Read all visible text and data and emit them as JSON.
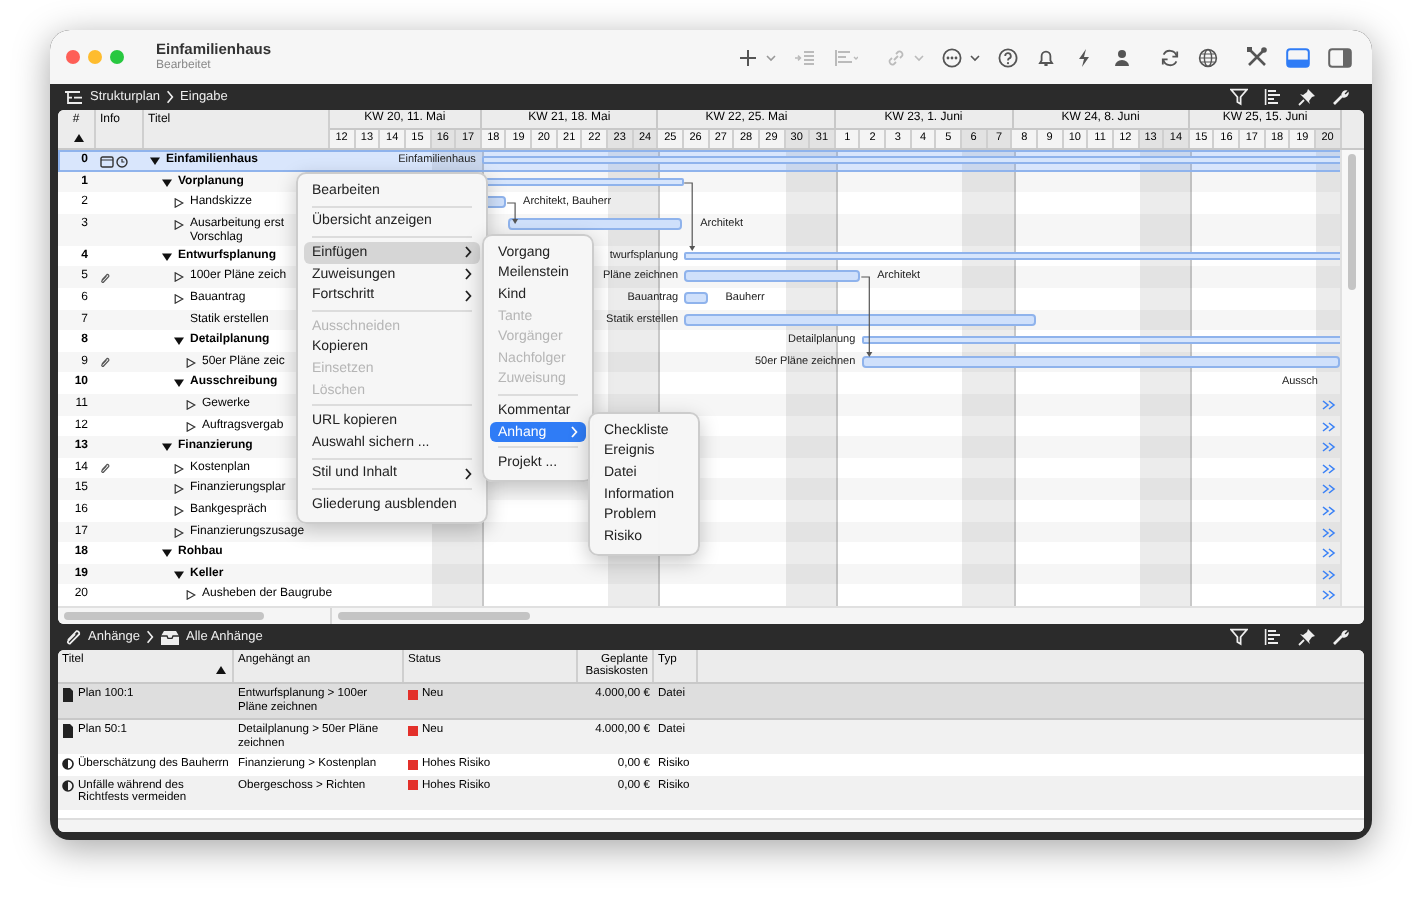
{
  "window": {
    "title": "Einfamilienhaus",
    "subtitle": "Bearbeitet"
  },
  "toolbar": {
    "panel_toggles": [
      {
        "selected": true
      },
      {
        "selected": false
      }
    ]
  },
  "breadcrumb": [
    "Strukturplan",
    "Eingabe"
  ],
  "outline": {
    "columns": [
      {
        "label": "#",
        "sorted": true
      },
      {
        "label": "Info",
        "sorted": false
      },
      {
        "label": "Titel",
        "sorted": false
      }
    ],
    "weeks": [
      {
        "label": "KW 20, 11. Mai",
        "days": [
          {
            "label": "12",
            "weekend": false
          },
          {
            "label": "13",
            "weekend": false
          },
          {
            "label": "14",
            "weekend": false
          },
          {
            "label": "15",
            "weekend": false
          },
          {
            "label": "16",
            "weekend": true
          },
          {
            "label": "17",
            "weekend": true
          }
        ]
      },
      {
        "label": "KW 21, 18. Mai",
        "days": [
          {
            "label": "18",
            "weekend": false
          },
          {
            "label": "19",
            "weekend": false
          },
          {
            "label": "20",
            "weekend": false
          },
          {
            "label": "21",
            "weekend": false
          },
          {
            "label": "22",
            "weekend": false
          },
          {
            "label": "23",
            "weekend": true
          },
          {
            "label": "24",
            "weekend": true
          }
        ]
      },
      {
        "label": "KW 22, 25. Mai",
        "days": [
          {
            "label": "25",
            "weekend": false
          },
          {
            "label": "26",
            "weekend": false
          },
          {
            "label": "27",
            "weekend": false
          },
          {
            "label": "28",
            "weekend": false
          },
          {
            "label": "29",
            "weekend": false
          },
          {
            "label": "30",
            "weekend": true
          },
          {
            "label": "31",
            "weekend": true
          }
        ]
      },
      {
        "label": "KW 23, 1. Juni",
        "days": [
          {
            "label": "1",
            "weekend": false
          },
          {
            "label": "2",
            "weekend": false
          },
          {
            "label": "3",
            "weekend": false
          },
          {
            "label": "4",
            "weekend": false
          },
          {
            "label": "5",
            "weekend": false
          },
          {
            "label": "6",
            "weekend": true
          },
          {
            "label": "7",
            "weekend": true
          }
        ]
      },
      {
        "label": "KW 24, 8. Juni",
        "days": [
          {
            "label": "8",
            "weekend": false
          },
          {
            "label": "9",
            "weekend": false
          },
          {
            "label": "10",
            "weekend": false
          },
          {
            "label": "11",
            "weekend": false
          },
          {
            "label": "12",
            "weekend": false
          },
          {
            "label": "13",
            "weekend": true
          },
          {
            "label": "14",
            "weekend": true
          }
        ]
      },
      {
        "label": "KW 25, 15. Juni",
        "days": [
          {
            "label": "15",
            "weekend": false
          },
          {
            "label": "16",
            "weekend": false
          },
          {
            "label": "17",
            "weekend": false
          },
          {
            "label": "18",
            "weekend": false
          },
          {
            "label": "19",
            "weekend": false
          },
          {
            "label": "20",
            "weekend": true
          }
        ]
      }
    ],
    "rows": [
      {
        "number": "0",
        "title": "Einfamilienhaus",
        "selected": true,
        "expanded": true,
        "note": true,
        "deadline": true,
        "attachment": false,
        "more_right": false,
        "bar": {
          "kind": "summary"
        },
        "label_left": "Einfamilienhaus",
        "children": [
          {
            "number": "1",
            "title": "Vorplanung",
            "selected": false,
            "expanded": true,
            "attachment": false,
            "more_right": false,
            "bar": {
              "kind": "summary"
            },
            "children": [
              {
                "number": "2",
                "title": "Handskizze",
                "selected": false,
                "expanded": false,
                "attachment": false,
                "more_right": false,
                "bar": {
                  "kind": "task"
                },
                "label_right": "Architekt, Bauherr"
              },
              {
                "number": "3",
                "title": "Ausarbeitung erst\nVorschlag",
                "selected": false,
                "expanded": false,
                "attachment": false,
                "more_right": false,
                "bar": {
                  "kind": "task"
                },
                "label_right": "Architekt"
              }
            ]
          },
          {
            "number": "4",
            "title": "Entwurfsplanung",
            "selected": false,
            "expanded": true,
            "attachment": false,
            "more_right": false,
            "bar": {
              "kind": "summary"
            },
            "label_left": "twurfsplanung",
            "children": [
              {
                "number": "5",
                "title": "100er Pläne zeich",
                "selected": false,
                "expanded": false,
                "attachment": true,
                "more_right": false,
                "bar": {
                  "kind": "task"
                },
                "label_left": "Pläne zeichnen",
                "label_right": "Architekt"
              },
              {
                "number": "6",
                "title": "Bauantrag",
                "selected": false,
                "expanded": false,
                "attachment": false,
                "more_right": false,
                "bar": {
                  "kind": "task"
                },
                "label_left": "Bauantrag",
                "label_right": "Bauherr"
              },
              {
                "number": "7",
                "title": "Statik erstellen",
                "selected": false,
                "attachment": false,
                "more_right": false,
                "bar": {
                  "kind": "task"
                },
                "label_left": "Statik erstellen"
              },
              {
                "number": "8",
                "title": "Detailplanung",
                "selected": false,
                "expanded": true,
                "attachment": false,
                "more_right": false,
                "bar": {
                  "kind": "summary"
                },
                "label_left": "Detailplanung",
                "children": [
                  {
                    "number": "9",
                    "title": "50er Pläne zeic",
                    "selected": false,
                    "expanded": false,
                    "attachment": true,
                    "more_right": false,
                    "bar": {
                      "kind": "task"
                    },
                    "label_left": "50er Pläne zeichnen"
                  }
                ]
              },
              {
                "number": "10",
                "title": "Ausschreibung",
                "selected": false,
                "expanded": true,
                "attachment": false,
                "more_right": false,
                "label_left": "Aussch",
                "children": [
                  {
                    "number": "11",
                    "title": "Gewerke",
                    "selected": false,
                    "expanded": false,
                    "attachment": false,
                    "more_right": true
                  },
                  {
                    "number": "12",
                    "title": "Auftragsvergab",
                    "selected": false,
                    "expanded": false,
                    "attachment": false,
                    "more_right": true
                  }
                ]
              }
            ]
          },
          {
            "number": "13",
            "title": "Finanzierung",
            "selected": false,
            "expanded": true,
            "attachment": false,
            "more_right": true,
            "children": [
              {
                "number": "14",
                "title": "Kostenplan",
                "selected": false,
                "expanded": false,
                "attachment": true,
                "more_right": true
              },
              {
                "number": "15",
                "title": "Finanzierungsplar",
                "selected": false,
                "expanded": false,
                "attachment": false,
                "more_right": true
              },
              {
                "number": "16",
                "title": "Bankgespräch",
                "selected": false,
                "expanded": false,
                "attachment": false,
                "more_right": true
              },
              {
                "number": "17",
                "title": "Finanzierungszusage",
                "selected": false,
                "expanded": false,
                "attachment": false,
                "more_right": true
              }
            ]
          },
          {
            "number": "18",
            "title": "Rohbau",
            "selected": false,
            "expanded": true,
            "attachment": false,
            "more_right": true,
            "children": [
              {
                "number": "19",
                "title": "Keller",
                "selected": false,
                "expanded": true,
                "attachment": false,
                "more_right": true,
                "children": [
                  {
                    "number": "20",
                    "title": "Ausheben der Baugrube",
                    "selected": false,
                    "expanded": false,
                    "attachment": false,
                    "more_right": true
                  }
                ]
              }
            ]
          }
        ]
      }
    ]
  },
  "context_menu": [
    {
      "kind": "item",
      "label": "Bearbeiten",
      "disabled": false,
      "submenu": false,
      "selected": false
    },
    {
      "kind": "separator"
    },
    {
      "kind": "item",
      "label": "Übersicht anzeigen",
      "disabled": false,
      "submenu": false,
      "selected": false
    },
    {
      "kind": "separator"
    },
    {
      "kind": "item",
      "label": "Einfügen",
      "disabled": false,
      "submenu": true,
      "selected": true
    },
    {
      "kind": "item",
      "label": "Zuweisungen",
      "disabled": false,
      "submenu": true,
      "selected": false
    },
    {
      "kind": "item",
      "label": "Fortschritt",
      "disabled": false,
      "submenu": true,
      "selected": false
    },
    {
      "kind": "separator"
    },
    {
      "kind": "item",
      "label": "Ausschneiden",
      "disabled": true,
      "submenu": false,
      "selected": false
    },
    {
      "kind": "item",
      "label": "Kopieren",
      "disabled": false,
      "submenu": false,
      "selected": false
    },
    {
      "kind": "item",
      "label": "Einsetzen",
      "disabled": true,
      "submenu": false,
      "selected": false
    },
    {
      "kind": "item",
      "label": "Löschen",
      "disabled": true,
      "submenu": false,
      "selected": false
    },
    {
      "kind": "separator"
    },
    {
      "kind": "item",
      "label": "URL kopieren",
      "disabled": false,
      "submenu": false,
      "selected": false
    },
    {
      "kind": "item",
      "label": "Auswahl sichern ...",
      "disabled": false,
      "submenu": false,
      "selected": false
    },
    {
      "kind": "separator"
    },
    {
      "kind": "item",
      "label": "Stil und Inhalt",
      "disabled": false,
      "submenu": true,
      "selected": false
    },
    {
      "kind": "separator"
    },
    {
      "kind": "item",
      "label": "Gliederung ausblenden",
      "disabled": false,
      "submenu": false,
      "selected": false
    }
  ],
  "insert_submenu": [
    {
      "kind": "item",
      "label": "Vorgang",
      "disabled": false,
      "submenu": false,
      "selected": false
    },
    {
      "kind": "item",
      "label": "Meilenstein",
      "disabled": false,
      "submenu": false,
      "selected": false
    },
    {
      "kind": "item",
      "label": "Kind",
      "disabled": false,
      "submenu": false,
      "selected": false
    },
    {
      "kind": "item",
      "label": "Tante",
      "disabled": true,
      "submenu": false,
      "selected": false
    },
    {
      "kind": "item",
      "label": "Vorgänger",
      "disabled": true,
      "submenu": false,
      "selected": false
    },
    {
      "kind": "item",
      "label": "Nachfolger",
      "disabled": true,
      "submenu": false,
      "selected": false
    },
    {
      "kind": "item",
      "label": "Zuweisung",
      "disabled": true,
      "submenu": false,
      "selected": false
    },
    {
      "kind": "separator"
    },
    {
      "kind": "item",
      "label": "Kommentar",
      "disabled": false,
      "submenu": false,
      "selected": false
    },
    {
      "kind": "item",
      "label": "Anhang",
      "disabled": false,
      "submenu": true,
      "selected": true
    },
    {
      "kind": "separator"
    },
    {
      "kind": "item",
      "label": "Projekt ...",
      "disabled": false,
      "submenu": false,
      "selected": false
    }
  ],
  "attachment_submenu": [
    {
      "kind": "item",
      "label": "Checkliste",
      "disabled": false,
      "submenu": false,
      "selected": false
    },
    {
      "kind": "item",
      "label": "Ereignis",
      "disabled": false,
      "submenu": false,
      "selected": false
    },
    {
      "kind": "item",
      "label": "Datei",
      "disabled": false,
      "submenu": false,
      "selected": false
    },
    {
      "kind": "item",
      "label": "Information",
      "disabled": false,
      "submenu": false,
      "selected": false
    },
    {
      "kind": "item",
      "label": "Problem",
      "disabled": false,
      "submenu": false,
      "selected": false
    },
    {
      "kind": "item",
      "label": "Risiko",
      "disabled": false,
      "submenu": false,
      "selected": false
    }
  ],
  "attachments": {
    "breadcrumb": [
      "Anhänge",
      "Alle Anhänge"
    ],
    "columns": [
      {
        "label": "Titel",
        "sorted": true
      },
      {
        "label": "Angehängt an",
        "sorted": false
      },
      {
        "label": "Status",
        "sorted": false
      },
      {
        "label": "Geplante Basiskosten",
        "sorted": false
      },
      {
        "label": "Typ",
        "sorted": false
      }
    ],
    "rows": [
      {
        "kind": "file",
        "title": "Plan 100:1",
        "attached_to": "Entwurfsplanung > 100er Pläne zeichnen",
        "status": "Neu",
        "color": "#e3302a",
        "cost": "4.000,00 €",
        "type": "Datei",
        "selected": true
      },
      {
        "kind": "file",
        "title": "Plan 50:1",
        "attached_to": "Detailplanung > 50er Pläne zeichnen",
        "status": "Neu",
        "color": "#e3302a",
        "cost": "4.000,00 €",
        "type": "Datei",
        "selected": false
      },
      {
        "kind": "risk",
        "title": "Überschätzung des Bauherrn",
        "attached_to": "Finanzierung > Kostenplan",
        "status": "Hohes Risiko",
        "color": "#e3302a",
        "cost": "0,00 €",
        "type": "Risiko",
        "selected": false
      },
      {
        "kind": "risk",
        "title": "Unfälle während des Richtfests vermeiden",
        "attached_to": "Obergeschoss > Richten",
        "status": "Hohes Risiko",
        "color": "#e3302a",
        "cost": "0,00 €",
        "type": "Risiko",
        "selected": false
      }
    ]
  }
}
